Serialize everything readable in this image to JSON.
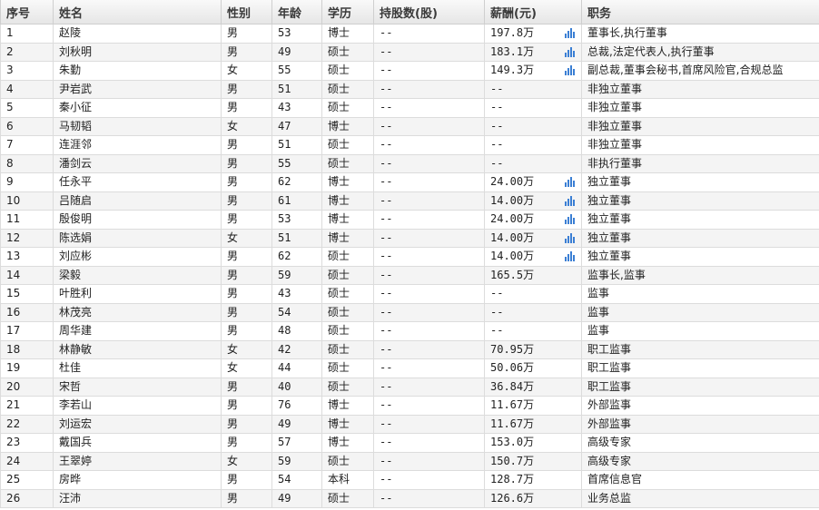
{
  "headers": [
    "序号",
    "姓名",
    "性别",
    "年龄",
    "学历",
    "持股数(股)",
    "薪酬(元)",
    "职务"
  ],
  "icon": "bar-chart-icon",
  "accent": "#3b7fd4",
  "rows": [
    {
      "no": "1",
      "name": "赵陵",
      "gender": "男",
      "age": "53",
      "edu": "博士",
      "shares": "--",
      "pay": "197.8万",
      "chart": true,
      "title": "董事长,执行董事"
    },
    {
      "no": "2",
      "name": "刘秋明",
      "gender": "男",
      "age": "49",
      "edu": "硕士",
      "shares": "--",
      "pay": "183.1万",
      "chart": true,
      "title": "总裁,法定代表人,执行董事"
    },
    {
      "no": "3",
      "name": "朱勤",
      "gender": "女",
      "age": "55",
      "edu": "硕士",
      "shares": "--",
      "pay": "149.3万",
      "chart": true,
      "title": "副总裁,董事会秘书,首席风险官,合规总监"
    },
    {
      "no": "4",
      "name": "尹岩武",
      "gender": "男",
      "age": "51",
      "edu": "硕士",
      "shares": "--",
      "pay": "--",
      "chart": false,
      "title": "非独立董事"
    },
    {
      "no": "5",
      "name": "秦小征",
      "gender": "男",
      "age": "43",
      "edu": "硕士",
      "shares": "--",
      "pay": "--",
      "chart": false,
      "title": "非独立董事"
    },
    {
      "no": "6",
      "name": "马韧韬",
      "gender": "女",
      "age": "47",
      "edu": "博士",
      "shares": "--",
      "pay": "--",
      "chart": false,
      "title": "非独立董事"
    },
    {
      "no": "7",
      "name": "连涯邻",
      "gender": "男",
      "age": "51",
      "edu": "硕士",
      "shares": "--",
      "pay": "--",
      "chart": false,
      "title": "非独立董事"
    },
    {
      "no": "8",
      "name": "潘剑云",
      "gender": "男",
      "age": "55",
      "edu": "硕士",
      "shares": "--",
      "pay": "--",
      "chart": false,
      "title": "非执行董事"
    },
    {
      "no": "9",
      "name": "任永平",
      "gender": "男",
      "age": "62",
      "edu": "博士",
      "shares": "--",
      "pay": "24.00万",
      "chart": true,
      "title": "独立董事"
    },
    {
      "no": "10",
      "name": "吕随启",
      "gender": "男",
      "age": "61",
      "edu": "博士",
      "shares": "--",
      "pay": "14.00万",
      "chart": true,
      "title": "独立董事"
    },
    {
      "no": "11",
      "name": "殷俊明",
      "gender": "男",
      "age": "53",
      "edu": "博士",
      "shares": "--",
      "pay": "24.00万",
      "chart": true,
      "title": "独立董事"
    },
    {
      "no": "12",
      "name": "陈选娟",
      "gender": "女",
      "age": "51",
      "edu": "博士",
      "shares": "--",
      "pay": "14.00万",
      "chart": true,
      "title": "独立董事"
    },
    {
      "no": "13",
      "name": "刘应彬",
      "gender": "男",
      "age": "62",
      "edu": "硕士",
      "shares": "--",
      "pay": "14.00万",
      "chart": true,
      "title": "独立董事"
    },
    {
      "no": "14",
      "name": "梁毅",
      "gender": "男",
      "age": "59",
      "edu": "硕士",
      "shares": "--",
      "pay": "165.5万",
      "chart": false,
      "title": "监事长,监事"
    },
    {
      "no": "15",
      "name": "叶胜利",
      "gender": "男",
      "age": "43",
      "edu": "硕士",
      "shares": "--",
      "pay": "--",
      "chart": false,
      "title": "监事"
    },
    {
      "no": "16",
      "name": "林茂亮",
      "gender": "男",
      "age": "54",
      "edu": "硕士",
      "shares": "--",
      "pay": "--",
      "chart": false,
      "title": "监事"
    },
    {
      "no": "17",
      "name": "周华建",
      "gender": "男",
      "age": "48",
      "edu": "硕士",
      "shares": "--",
      "pay": "--",
      "chart": false,
      "title": "监事"
    },
    {
      "no": "18",
      "name": "林静敏",
      "gender": "女",
      "age": "42",
      "edu": "硕士",
      "shares": "--",
      "pay": "70.95万",
      "chart": false,
      "title": "职工监事"
    },
    {
      "no": "19",
      "name": "杜佳",
      "gender": "女",
      "age": "44",
      "edu": "硕士",
      "shares": "--",
      "pay": "50.06万",
      "chart": false,
      "title": "职工监事"
    },
    {
      "no": "20",
      "name": "宋哲",
      "gender": "男",
      "age": "40",
      "edu": "硕士",
      "shares": "--",
      "pay": "36.84万",
      "chart": false,
      "title": "职工监事"
    },
    {
      "no": "21",
      "name": "李若山",
      "gender": "男",
      "age": "76",
      "edu": "博士",
      "shares": "--",
      "pay": "11.67万",
      "chart": false,
      "title": "外部监事"
    },
    {
      "no": "22",
      "name": "刘运宏",
      "gender": "男",
      "age": "49",
      "edu": "博士",
      "shares": "--",
      "pay": "11.67万",
      "chart": false,
      "title": "外部监事"
    },
    {
      "no": "23",
      "name": "戴国兵",
      "gender": "男",
      "age": "57",
      "edu": "博士",
      "shares": "--",
      "pay": "153.0万",
      "chart": false,
      "title": "高级专家"
    },
    {
      "no": "24",
      "name": "王翠婷",
      "gender": "女",
      "age": "59",
      "edu": "硕士",
      "shares": "--",
      "pay": "150.7万",
      "chart": false,
      "title": "高级专家"
    },
    {
      "no": "25",
      "name": "房晔",
      "gender": "男",
      "age": "54",
      "edu": "本科",
      "shares": "--",
      "pay": "128.7万",
      "chart": false,
      "title": "首席信息官"
    },
    {
      "no": "26",
      "name": "汪沛",
      "gender": "男",
      "age": "49",
      "edu": "硕士",
      "shares": "--",
      "pay": "126.6万",
      "chart": false,
      "title": "业务总监"
    }
  ]
}
